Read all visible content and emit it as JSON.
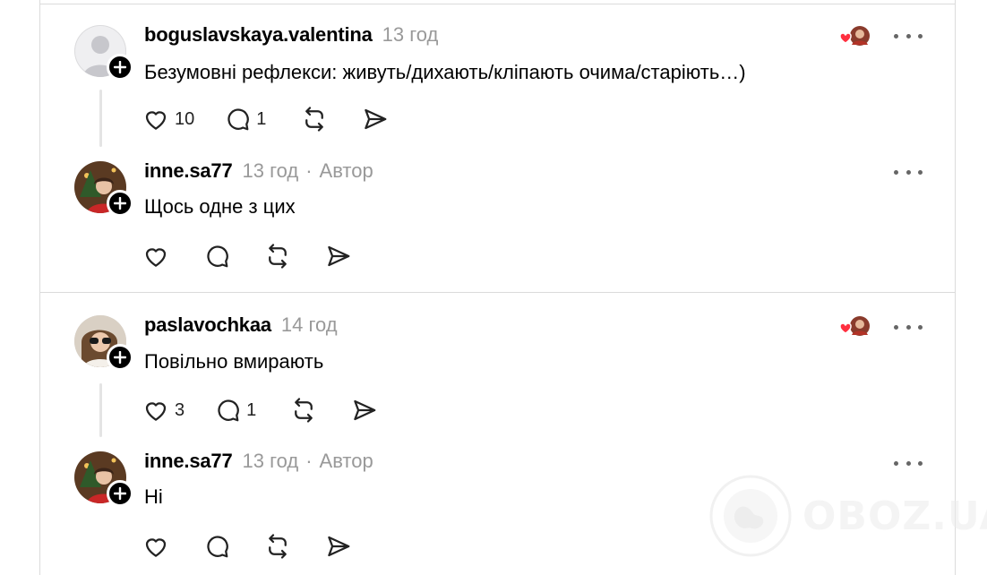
{
  "posts": [
    {
      "username": "boguslavskaya.valentina",
      "time": "13 год",
      "text": "Безумовні рефлекси: живуть/дихають/кліпають очима/старіють…)",
      "likes": "10",
      "replies": "1"
    },
    {
      "username": "inne.sa77",
      "time": "13 год",
      "author_badge": "Автор",
      "text": "Щось одне з цих"
    },
    {
      "username": "paslavochkaa",
      "time": "14 год",
      "text": "Повільно вмирають",
      "likes": "3",
      "replies": "1"
    },
    {
      "username": "inne.sa77",
      "time": "13 год",
      "author_badge": "Автор",
      "text": "Ні"
    }
  ],
  "separator": "·",
  "watermark": "OBOZ.UA",
  "icons": [
    "heart-icon",
    "comment-icon",
    "repost-icon",
    "share-icon",
    "more-icon",
    "plus-icon",
    "liked-by-author-icon"
  ],
  "colors": {
    "muted": "#999999",
    "like_red": "#ff3040",
    "divider": "#dbdbdb"
  }
}
